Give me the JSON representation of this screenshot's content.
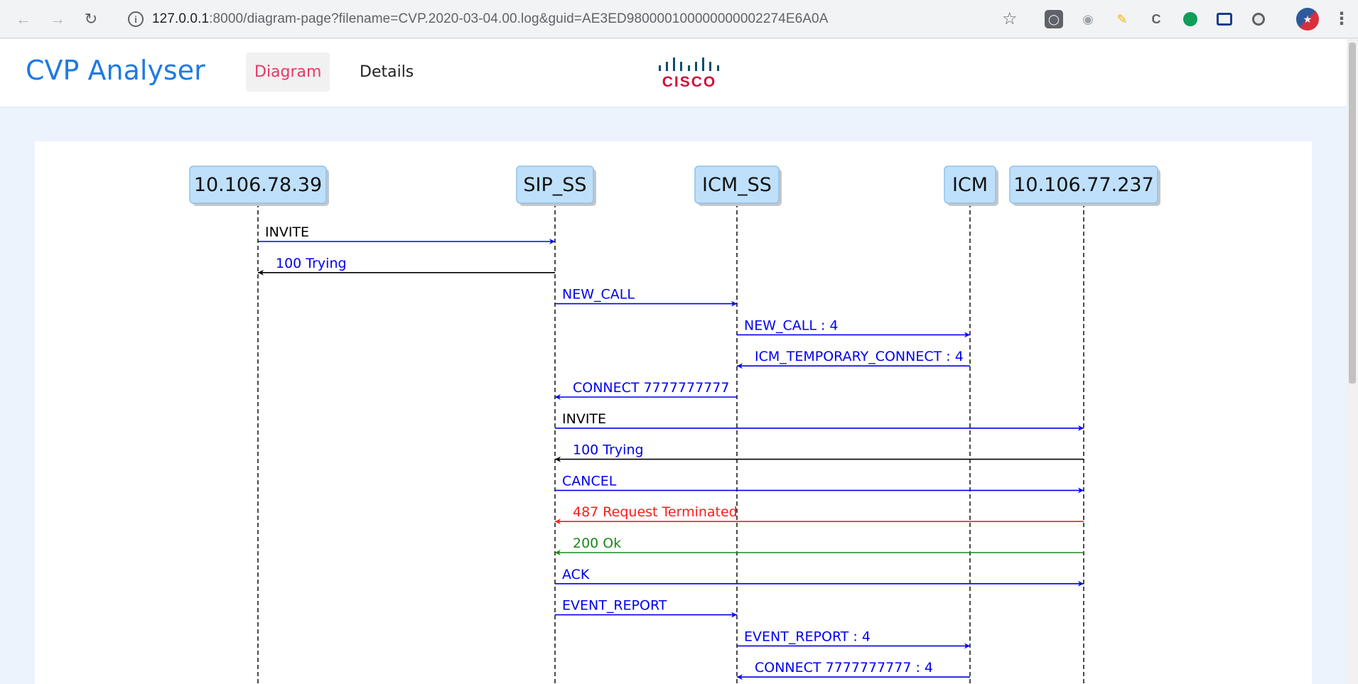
{
  "browser": {
    "url_host": "127.0.0.1",
    "url_rest": ":8000/diagram-page?filename=CVP.2020-03-04.00.log&guid=AE3ED980000100000000002274E6A0A",
    "icons": [
      "back-icon",
      "forward-icon",
      "reload-icon",
      "info-icon",
      "star-icon",
      "menu-icon"
    ]
  },
  "app": {
    "title": "CVP Analyser",
    "nav": [
      {
        "label": "Diagram",
        "active": true
      },
      {
        "label": "Details",
        "active": false
      }
    ],
    "logo_text": "CISCO"
  },
  "colors": {
    "brand": "#1f7ae0",
    "active_tab": "#e8376a",
    "blue": "#0000ee",
    "red": "#ff1a1a",
    "green": "#1a8a1a",
    "participant_fill": "#bfe0fb",
    "participant_border": "#8ec2ee"
  },
  "participants": [
    {
      "id": "p1",
      "label": "10.106.78.39"
    },
    {
      "id": "p2",
      "label": "SIP_SS"
    },
    {
      "id": "p3",
      "label": "ICM_SS"
    },
    {
      "id": "p4",
      "label": "ICM"
    },
    {
      "id": "p5",
      "label": "10.106.77.237"
    }
  ],
  "messages": [
    {
      "from": "p1",
      "to": "p2",
      "label": "INVITE",
      "line": "blue",
      "text": "black"
    },
    {
      "from": "p2",
      "to": "p1",
      "label": "100 Trying",
      "line": "black",
      "text": "blue"
    },
    {
      "from": "p2",
      "to": "p3",
      "label": "NEW_CALL",
      "line": "blue",
      "text": "blue"
    },
    {
      "from": "p3",
      "to": "p4",
      "label": "NEW_CALL : 4",
      "line": "blue",
      "text": "blue"
    },
    {
      "from": "p4",
      "to": "p3",
      "label": "ICM_TEMPORARY_CONNECT : 4",
      "line": "blue",
      "text": "blue"
    },
    {
      "from": "p3",
      "to": "p2",
      "label": "CONNECT 7777777777",
      "line": "blue",
      "text": "blue"
    },
    {
      "from": "p2",
      "to": "p5",
      "label": "INVITE",
      "line": "blue",
      "text": "black"
    },
    {
      "from": "p5",
      "to": "p2",
      "label": "100 Trying",
      "line": "black",
      "text": "blue"
    },
    {
      "from": "p2",
      "to": "p5",
      "label": "CANCEL",
      "line": "blue",
      "text": "blue"
    },
    {
      "from": "p5",
      "to": "p2",
      "label": "487 Request Terminated",
      "line": "red",
      "text": "red"
    },
    {
      "from": "p5",
      "to": "p2",
      "label": "200 Ok",
      "line": "green",
      "text": "green"
    },
    {
      "from": "p2",
      "to": "p5",
      "label": "ACK",
      "line": "blue",
      "text": "blue"
    },
    {
      "from": "p2",
      "to": "p3",
      "label": "EVENT_REPORT",
      "line": "blue",
      "text": "blue"
    },
    {
      "from": "p3",
      "to": "p4",
      "label": "EVENT_REPORT : 4",
      "line": "blue",
      "text": "blue"
    },
    {
      "from": "p4",
      "to": "p3",
      "label": "CONNECT 7777777777 : 4",
      "line": "blue",
      "text": "blue"
    }
  ]
}
